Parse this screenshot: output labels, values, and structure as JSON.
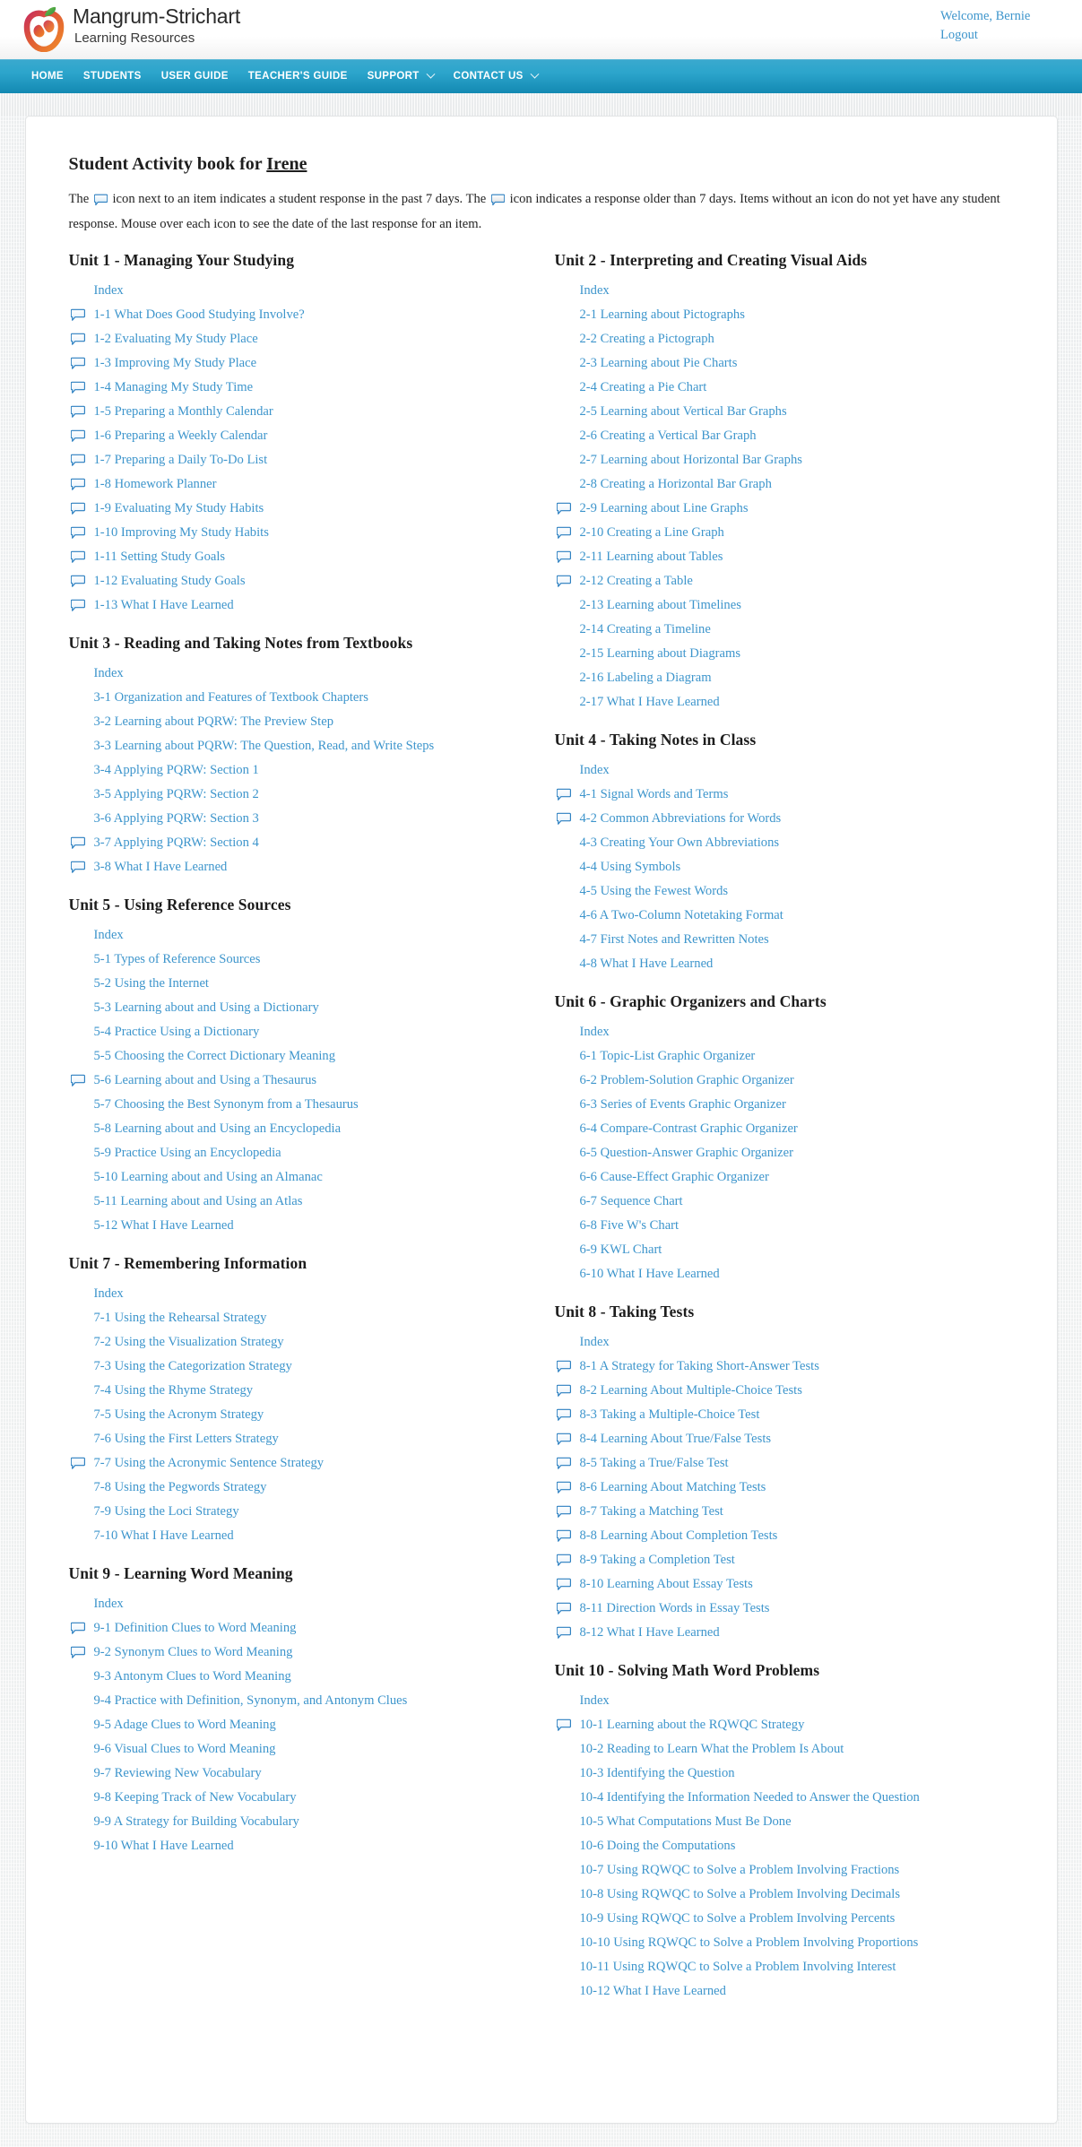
{
  "header": {
    "logo_icon": "apple-logo-icon",
    "brand_title": "Mangrum-Strichart",
    "brand_subtitle": "Learning Resources",
    "welcome": "Welcome, Bernie",
    "logout": "Logout"
  },
  "nav": {
    "items": [
      {
        "label": "HOME",
        "has_caret": false
      },
      {
        "label": "STUDENTS",
        "has_caret": false
      },
      {
        "label": "USER GUIDE",
        "has_caret": false
      },
      {
        "label": "TEACHER'S GUIDE",
        "has_caret": false
      },
      {
        "label": "SUPPORT",
        "has_caret": true
      },
      {
        "label": "CONTACT US",
        "has_caret": true
      }
    ]
  },
  "page": {
    "title_prefix": "Student Activity book for ",
    "title_student": "Irene",
    "description_part1": "The ",
    "description_part2": " icon next to an item indicates a student response in the past 7 days. The ",
    "description_part3": " icon indicates a response older than 7 days. Items without an icon do not yet have any student response. Mouse over each icon to see the date of the last response for an item.",
    "index_label": "Index"
  },
  "colors": {
    "link": "#3d95cc",
    "nav_top": "#3aa9ce",
    "nav_bottom": "#1389b2",
    "bubble_border": "#2b7fc0",
    "bubble_fill": "#eaf4fc"
  },
  "left_units": [
    {
      "title": "Unit 1 - Managing Your Studying",
      "items": [
        {
          "label": "Index",
          "icon": false
        },
        {
          "label": "1-1 What Does Good Studying Involve?",
          "icon": true
        },
        {
          "label": "1-2 Evaluating My Study Place",
          "icon": true
        },
        {
          "label": "1-3 Improving My Study Place",
          "icon": true
        },
        {
          "label": "1-4 Managing My Study Time",
          "icon": true
        },
        {
          "label": "1-5 Preparing a Monthly Calendar",
          "icon": true
        },
        {
          "label": "1-6 Preparing a Weekly Calendar",
          "icon": true
        },
        {
          "label": "1-7 Preparing a Daily To-Do List",
          "icon": true
        },
        {
          "label": "1-8 Homework Planner",
          "icon": true
        },
        {
          "label": "1-9 Evaluating My Study Habits",
          "icon": true
        },
        {
          "label": "1-10 Improving My Study Habits",
          "icon": true
        },
        {
          "label": "1-11 Setting Study Goals",
          "icon": true
        },
        {
          "label": "1-12 Evaluating Study Goals",
          "icon": true
        },
        {
          "label": "1-13 What I Have Learned",
          "icon": true
        }
      ]
    },
    {
      "title": "Unit 3 - Reading and Taking Notes from Textbooks",
      "items": [
        {
          "label": "Index",
          "icon": false
        },
        {
          "label": "3-1 Organization and Features of Textbook Chapters",
          "icon": false
        },
        {
          "label": "3-2 Learning about PQRW: The Preview Step",
          "icon": false
        },
        {
          "label": "3-3 Learning about PQRW: The Question, Read, and Write Steps",
          "icon": false
        },
        {
          "label": "3-4 Applying PQRW: Section 1",
          "icon": false
        },
        {
          "label": "3-5 Applying PQRW: Section 2",
          "icon": false
        },
        {
          "label": "3-6 Applying PQRW: Section 3",
          "icon": false
        },
        {
          "label": "3-7 Applying PQRW: Section 4",
          "icon": true
        },
        {
          "label": "3-8 What I Have Learned",
          "icon": true
        }
      ]
    },
    {
      "title": "Unit 5 - Using Reference Sources",
      "items": [
        {
          "label": "Index",
          "icon": false
        },
        {
          "label": "5-1 Types of Reference Sources",
          "icon": false
        },
        {
          "label": "5-2 Using the Internet",
          "icon": false
        },
        {
          "label": "5-3 Learning about and Using a Dictionary",
          "icon": false
        },
        {
          "label": "5-4 Practice Using a Dictionary",
          "icon": false
        },
        {
          "label": "5-5 Choosing the Correct Dictionary Meaning",
          "icon": false
        },
        {
          "label": "5-6 Learning about and Using a Thesaurus",
          "icon": true
        },
        {
          "label": "5-7 Choosing the Best Synonym from a Thesaurus",
          "icon": false
        },
        {
          "label": "5-8 Learning about and Using an Encyclopedia",
          "icon": false
        },
        {
          "label": "5-9 Practice Using an Encyclopedia",
          "icon": false
        },
        {
          "label": "5-10 Learning about and Using an Almanac",
          "icon": false
        },
        {
          "label": "5-11 Learning about and Using an Atlas",
          "icon": false
        },
        {
          "label": "5-12 What I Have Learned",
          "icon": false
        }
      ]
    },
    {
      "title": "Unit 7 - Remembering Information",
      "items": [
        {
          "label": "Index",
          "icon": false
        },
        {
          "label": "7-1 Using the Rehearsal Strategy",
          "icon": false
        },
        {
          "label": "7-2 Using the Visualization Strategy",
          "icon": false
        },
        {
          "label": "7-3 Using the Categorization Strategy",
          "icon": false
        },
        {
          "label": "7-4 Using the Rhyme Strategy",
          "icon": false
        },
        {
          "label": "7-5 Using the Acronym Strategy",
          "icon": false
        },
        {
          "label": "7-6 Using the First Letters Strategy",
          "icon": false
        },
        {
          "label": "7-7 Using the Acronymic Sentence Strategy",
          "icon": true
        },
        {
          "label": "7-8 Using the Pegwords Strategy",
          "icon": false
        },
        {
          "label": "7-9 Using the Loci Strategy",
          "icon": false
        },
        {
          "label": "7-10 What I Have Learned",
          "icon": false
        }
      ]
    },
    {
      "title": "Unit 9 - Learning Word Meaning",
      "items": [
        {
          "label": "Index",
          "icon": false
        },
        {
          "label": "9-1 Definition Clues to Word Meaning",
          "icon": true
        },
        {
          "label": "9-2 Synonym Clues to Word Meaning",
          "icon": true
        },
        {
          "label": "9-3 Antonym Clues to Word Meaning",
          "icon": false
        },
        {
          "label": "9-4 Practice with Definition, Synonym, and Antonym Clues",
          "icon": false
        },
        {
          "label": "9-5 Adage Clues to Word Meaning",
          "icon": false
        },
        {
          "label": "9-6 Visual Clues to Word Meaning",
          "icon": false
        },
        {
          "label": "9-7 Reviewing New Vocabulary",
          "icon": false
        },
        {
          "label": "9-8 Keeping Track of New Vocabulary",
          "icon": false
        },
        {
          "label": "9-9 A Strategy for Building Vocabulary",
          "icon": false
        },
        {
          "label": "9-10 What I Have Learned",
          "icon": false
        }
      ]
    }
  ],
  "right_units": [
    {
      "title": "Unit 2 - Interpreting and Creating Visual Aids",
      "items": [
        {
          "label": "Index",
          "icon": false
        },
        {
          "label": "2-1 Learning about Pictographs",
          "icon": false
        },
        {
          "label": "2-2 Creating a Pictograph",
          "icon": false
        },
        {
          "label": "2-3 Learning about Pie Charts",
          "icon": false
        },
        {
          "label": "2-4 Creating a Pie Chart",
          "icon": false
        },
        {
          "label": "2-5 Learning about Vertical Bar Graphs",
          "icon": false
        },
        {
          "label": "2-6 Creating a Vertical Bar Graph",
          "icon": false
        },
        {
          "label": "2-7 Learning about Horizontal Bar Graphs",
          "icon": false
        },
        {
          "label": "2-8 Creating a Horizontal Bar Graph",
          "icon": false
        },
        {
          "label": "2-9 Learning about Line Graphs",
          "icon": true
        },
        {
          "label": "2-10 Creating a Line Graph",
          "icon": true
        },
        {
          "label": "2-11 Learning about Tables",
          "icon": true
        },
        {
          "label": "2-12 Creating a Table",
          "icon": true
        },
        {
          "label": "2-13 Learning about Timelines",
          "icon": false
        },
        {
          "label": "2-14 Creating a Timeline",
          "icon": false
        },
        {
          "label": "2-15 Learning about Diagrams",
          "icon": false
        },
        {
          "label": "2-16 Labeling a Diagram",
          "icon": false
        },
        {
          "label": "2-17 What I Have Learned",
          "icon": false
        }
      ]
    },
    {
      "title": "Unit 4 - Taking Notes in Class",
      "items": [
        {
          "label": "Index",
          "icon": false
        },
        {
          "label": "4-1 Signal Words and Terms",
          "icon": true
        },
        {
          "label": "4-2 Common Abbreviations for Words",
          "icon": true
        },
        {
          "label": "4-3 Creating Your Own Abbreviations",
          "icon": false
        },
        {
          "label": "4-4 Using Symbols",
          "icon": false
        },
        {
          "label": "4-5 Using the Fewest Words",
          "icon": false
        },
        {
          "label": "4-6 A Two-Column Notetaking Format",
          "icon": false
        },
        {
          "label": "4-7 First Notes and Rewritten Notes",
          "icon": false
        },
        {
          "label": "4-8 What I Have Learned",
          "icon": false
        }
      ]
    },
    {
      "title": "Unit 6 - Graphic Organizers and Charts",
      "items": [
        {
          "label": "Index",
          "icon": false
        },
        {
          "label": "6-1 Topic-List Graphic Organizer",
          "icon": false
        },
        {
          "label": "6-2 Problem-Solution Graphic Organizer",
          "icon": false
        },
        {
          "label": "6-3 Series of Events Graphic Organizer",
          "icon": false
        },
        {
          "label": "6-4 Compare-Contrast Graphic Organizer",
          "icon": false
        },
        {
          "label": "6-5 Question-Answer Graphic Organizer",
          "icon": false
        },
        {
          "label": "6-6 Cause-Effect Graphic Organizer",
          "icon": false
        },
        {
          "label": "6-7 Sequence Chart",
          "icon": false
        },
        {
          "label": "6-8 Five W's Chart",
          "icon": false
        },
        {
          "label": "6-9 KWL Chart",
          "icon": false
        },
        {
          "label": "6-10 What I Have Learned",
          "icon": false
        }
      ]
    },
    {
      "title": "Unit 8 - Taking Tests",
      "items": [
        {
          "label": "Index",
          "icon": false
        },
        {
          "label": "8-1 A Strategy for Taking Short-Answer Tests",
          "icon": true
        },
        {
          "label": "8-2 Learning About Multiple-Choice Tests",
          "icon": true
        },
        {
          "label": "8-3 Taking a Multiple-Choice Test",
          "icon": true
        },
        {
          "label": "8-4 Learning About True/False Tests",
          "icon": true
        },
        {
          "label": "8-5 Taking a True/False Test",
          "icon": true
        },
        {
          "label": "8-6 Learning About Matching Tests",
          "icon": true
        },
        {
          "label": "8-7 Taking a Matching Test",
          "icon": true
        },
        {
          "label": "8-8 Learning About Completion Tests",
          "icon": true
        },
        {
          "label": "8-9 Taking a Completion Test",
          "icon": true
        },
        {
          "label": "8-10 Learning About Essay Tests",
          "icon": true
        },
        {
          "label": "8-11 Direction Words in Essay Tests",
          "icon": true
        },
        {
          "label": "8-12 What I Have Learned",
          "icon": true
        }
      ]
    },
    {
      "title": "Unit 10 - Solving Math Word Problems",
      "items": [
        {
          "label": "Index",
          "icon": false
        },
        {
          "label": "10-1 Learning about the RQWQC Strategy",
          "icon": true
        },
        {
          "label": "10-2 Reading to Learn What the Problem Is About",
          "icon": false
        },
        {
          "label": "10-3 Identifying the Question",
          "icon": false
        },
        {
          "label": "10-4 Identifying the Information Needed to Answer the Question",
          "icon": false
        },
        {
          "label": "10-5 What Computations Must Be Done",
          "icon": false
        },
        {
          "label": "10-6 Doing the Computations",
          "icon": false
        },
        {
          "label": "10-7 Using RQWQC to Solve a Problem Involving Fractions",
          "icon": false
        },
        {
          "label": "10-8 Using RQWQC to Solve a Problem Involving Decimals",
          "icon": false
        },
        {
          "label": "10-9 Using RQWQC to Solve a Problem Involving Percents",
          "icon": false
        },
        {
          "label": "10-10 Using RQWQC to Solve a Problem Involving Proportions",
          "icon": false
        },
        {
          "label": "10-11 Using RQWQC to Solve a Problem Involving Interest",
          "icon": false
        },
        {
          "label": "10-12 What I Have Learned",
          "icon": false
        }
      ]
    }
  ]
}
